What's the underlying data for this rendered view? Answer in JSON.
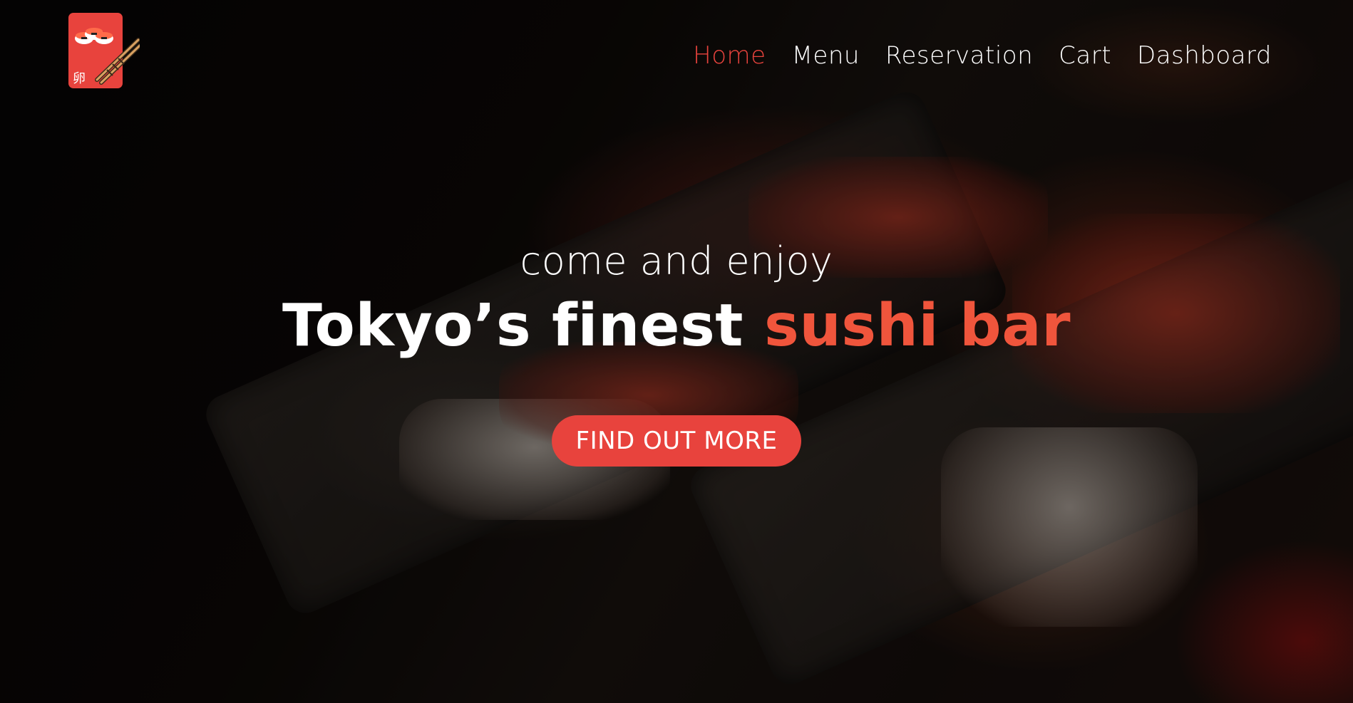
{
  "logo": {
    "icon": "sushi-chopsticks-logo-icon",
    "glyph": "卵",
    "accent_color": "#e8433d"
  },
  "nav": {
    "items": [
      {
        "label": "Home",
        "active": true
      },
      {
        "label": "Menu",
        "active": false
      },
      {
        "label": "Reservation",
        "active": false
      },
      {
        "label": "Cart",
        "active": false
      },
      {
        "label": "Dashboard",
        "active": false
      }
    ],
    "active_color": "#e8433d"
  },
  "hero": {
    "tagline": "come and enjoy",
    "headline_prefix": "Tokyo’s finest",
    "headline_accent": "sushi bar",
    "accent_color": "#f0553c",
    "cta_label": "FIND OUT MORE",
    "background": "sushi-plate-photo"
  }
}
